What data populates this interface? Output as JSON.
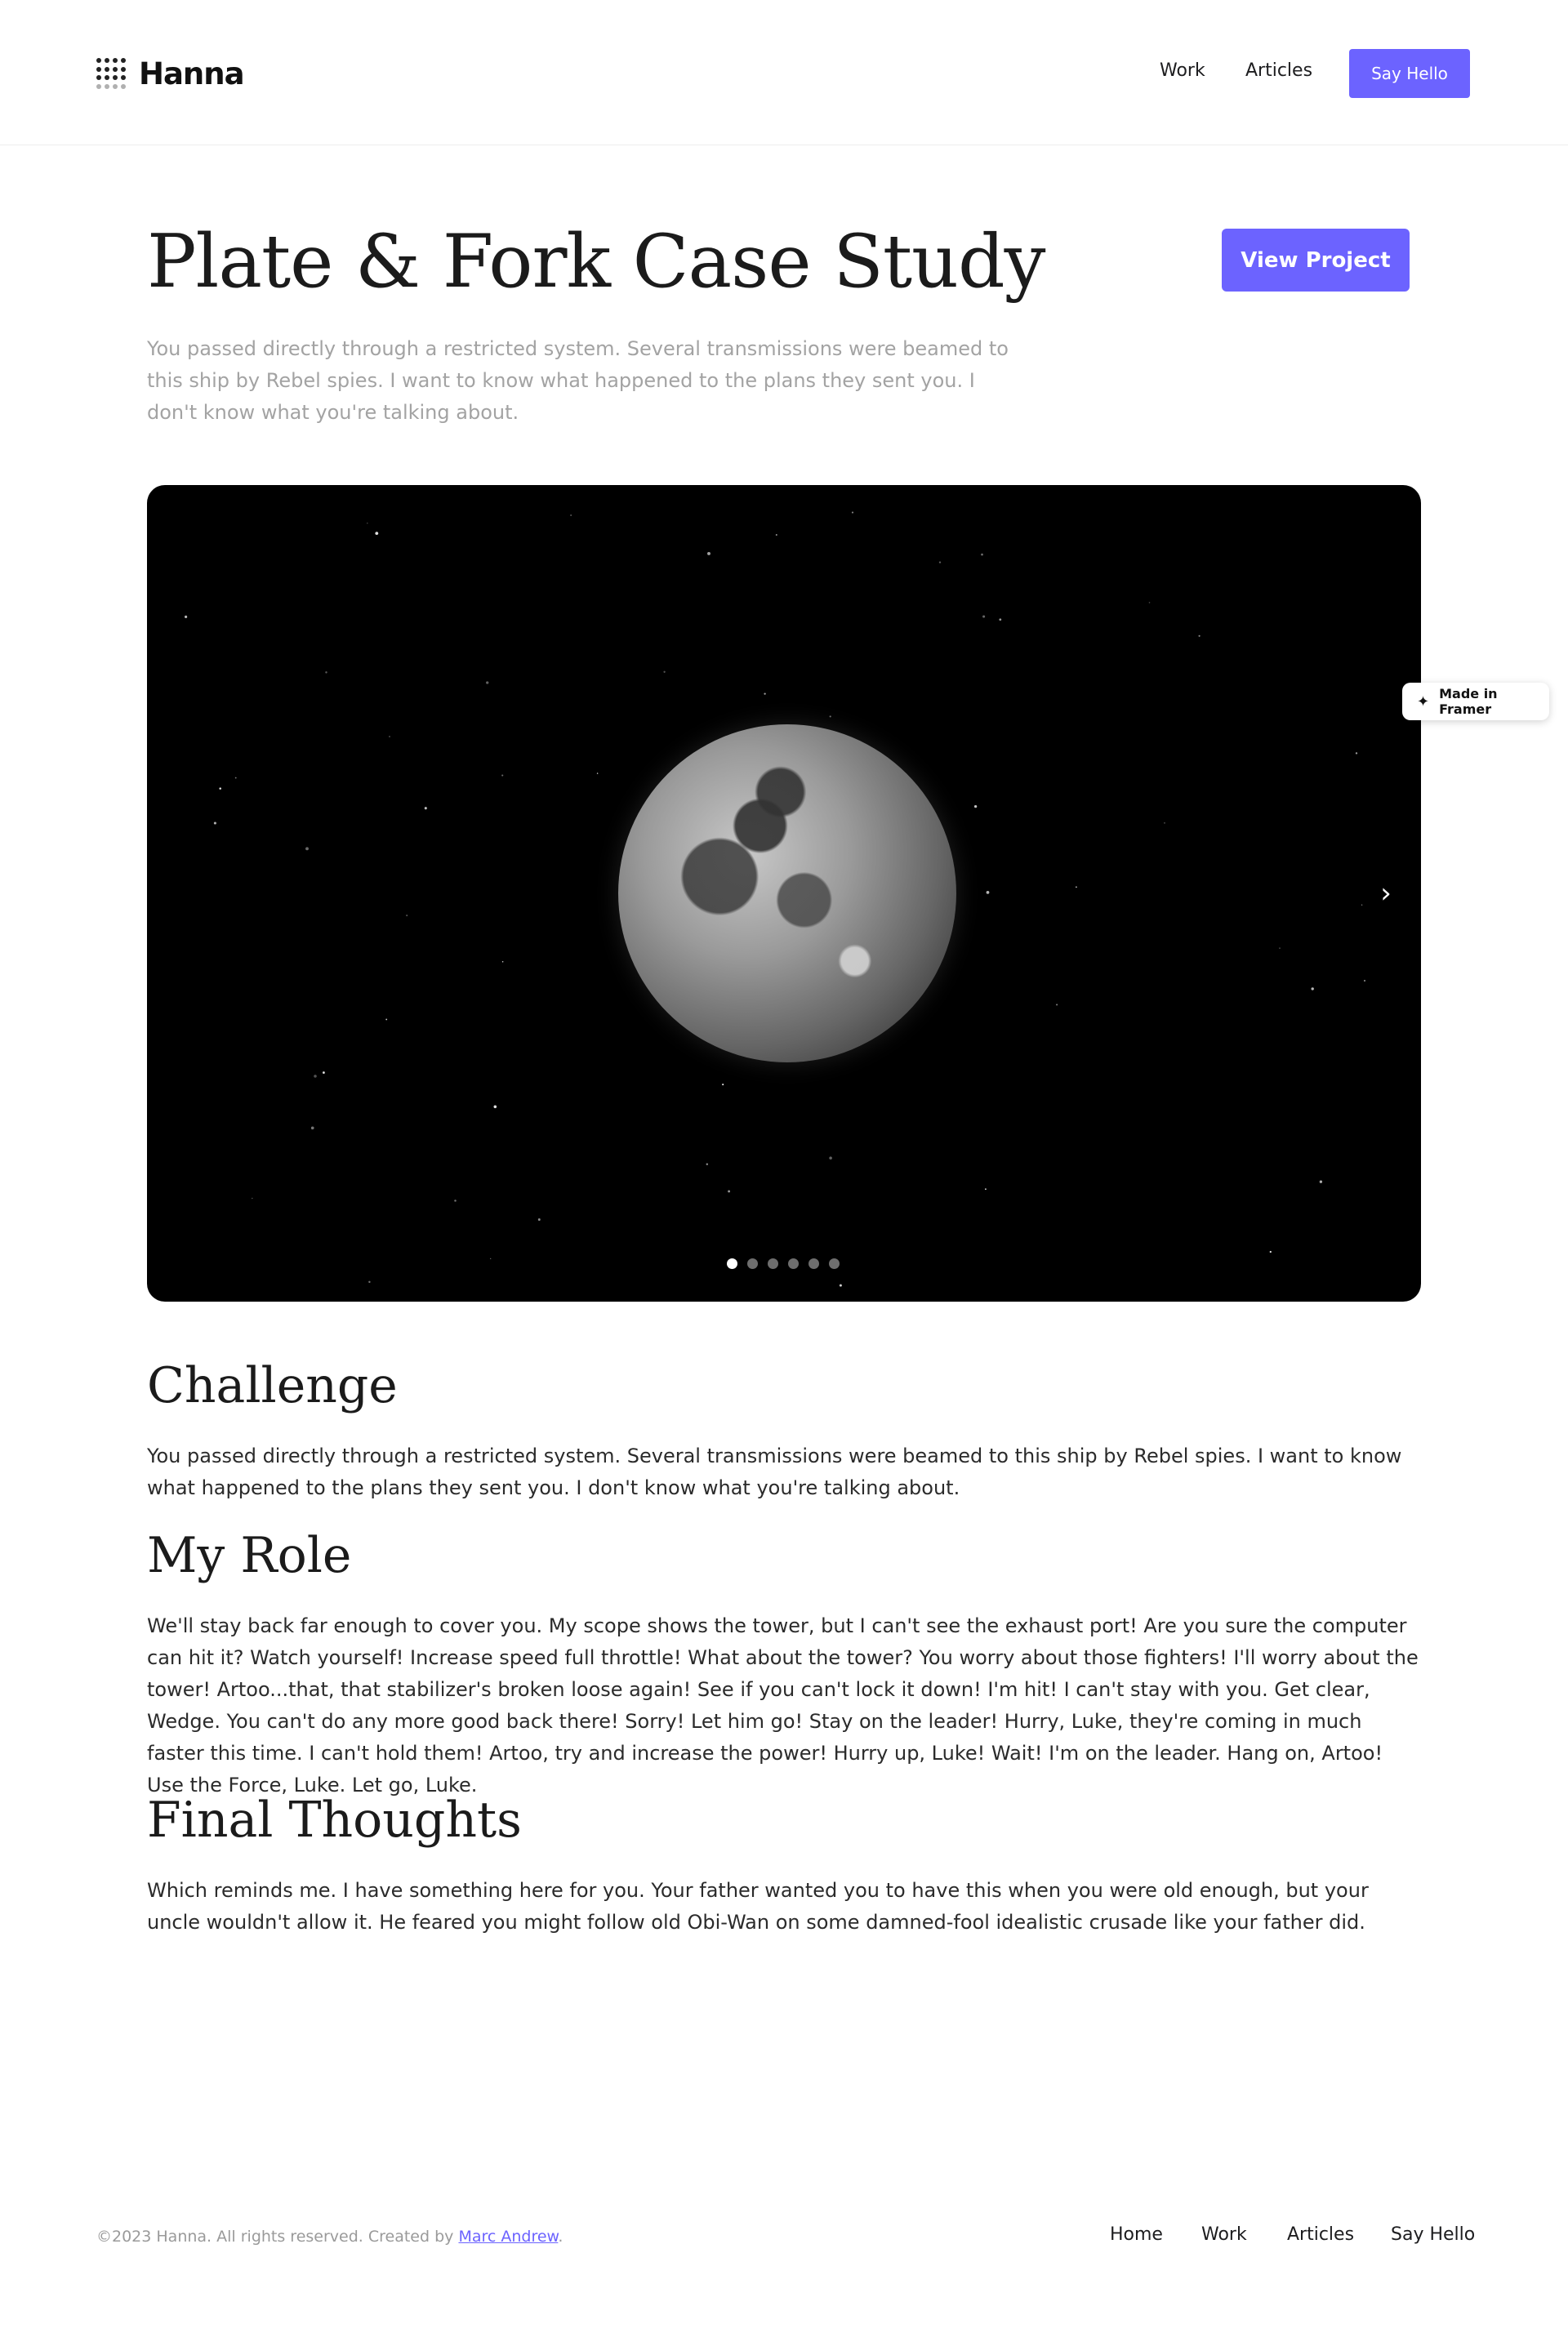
{
  "header": {
    "brand": "Hanna",
    "nav": {
      "work": "Work",
      "articles": "Articles"
    },
    "cta": "Say Hello"
  },
  "hero": {
    "title": "Plate & Fork Case Study",
    "intro": "You passed directly through a restricted system. Several transmissions were beamed to this ship by Rebel spies. I want to know what happened to the plans they sent you. I don't know what you're talking about.",
    "view_button": "View Project"
  },
  "slider": {
    "slide_count": 6,
    "active_index": 0,
    "next_icon": "chevron-right-icon"
  },
  "badge": {
    "label": "Made in Framer"
  },
  "sections": {
    "challenge": {
      "heading": "Challenge",
      "body": "You passed directly through a restricted system. Several transmissions were beamed to this ship by Rebel spies. I want to know what happened to the plans they sent you. I don't know what you're talking about."
    },
    "role": {
      "heading": "My Role",
      "body": "We'll stay back far enough to cover you. My scope shows the tower, but I can't see the exhaust port! Are you sure the computer can hit it? Watch yourself! Increase speed full throttle! What about the tower? You worry about those fighters! I'll worry about the tower! Artoo...that, that stabilizer's broken loose again! See if you can't lock it down! I'm hit! I can't stay with you. Get clear, Wedge. You can't do any more good back there! Sorry! Let him go! Stay on the leader! Hurry, Luke, they're coming in much faster this time. I can't hold them! Artoo, try and increase the power! Hurry up, Luke! Wait! I'm on the leader. Hang on, Artoo! Use the Force, Luke. Let go, Luke."
    },
    "thoughts": {
      "heading": "Final Thoughts",
      "body": "Which reminds me. I have something here for you. Your father wanted you to have this when you were old enough, but your uncle wouldn't allow it. He feared you might follow old Obi-Wan on some damned-fool idealistic crusade like your father did."
    }
  },
  "footer": {
    "copyright": "©2023 Hanna. All rights reserved. Created by ",
    "author": "Marc Andrew",
    "period": ".",
    "links": {
      "home": "Home",
      "work": "Work",
      "articles": "Articles",
      "hello": "Say Hello"
    }
  },
  "colors": {
    "accent": "#6c63ff",
    "text": "#1d1d1f",
    "muted": "#a3a3a3"
  }
}
